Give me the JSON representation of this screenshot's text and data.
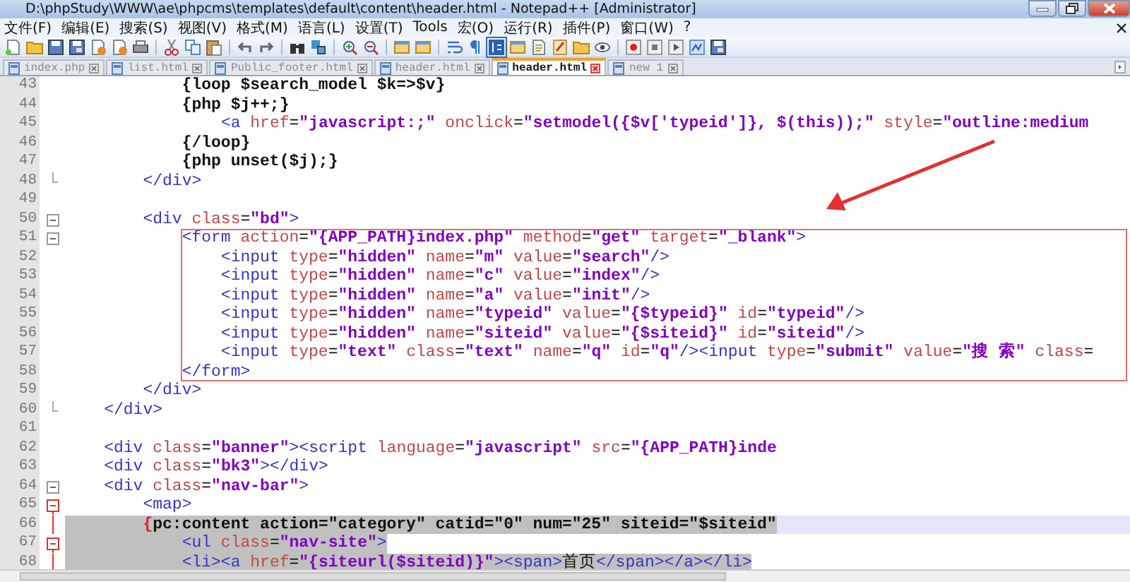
{
  "window": {
    "title": "D:\\phpStudy\\WWW\\ae\\phpcms\\templates\\default\\content\\header.html - Notepad++ [Administrator]"
  },
  "menu": [
    "文件(F)",
    "编辑(E)",
    "搜索(S)",
    "视图(V)",
    "格式(M)",
    "语言(L)",
    "设置(T)",
    "Tools",
    "宏(O)",
    "运行(R)",
    "插件(P)",
    "窗口(W)",
    "?"
  ],
  "tabs": [
    {
      "label": "index.php",
      "selected": false
    },
    {
      "label": "list.html",
      "selected": false
    },
    {
      "label": "Public_footer.html",
      "selected": false
    },
    {
      "label": "header.html",
      "selected": false
    },
    {
      "label": "header.html",
      "selected": true
    },
    {
      "label": "new 1",
      "selected": false
    }
  ],
  "editor": {
    "lines": [
      {
        "number": "43",
        "fold": false,
        "fold_end": false,
        "active": false,
        "current": false,
        "selected": false,
        "tokens": [
          {
            "kind": "tpl",
            "text": "            {loop $search_model $k=>$v}"
          }
        ]
      },
      {
        "number": "44",
        "fold": false,
        "fold_end": false,
        "active": false,
        "current": false,
        "selected": false,
        "tokens": [
          {
            "kind": "tpl",
            "text": "            {php $j++;}"
          }
        ]
      },
      {
        "number": "45",
        "fold": false,
        "fold_end": false,
        "active": false,
        "current": false,
        "selected": false,
        "tokens": [
          {
            "kind": "tag",
            "text": "                <a"
          },
          {
            "kind": "attr",
            "text": " href"
          },
          {
            "kind": "plain",
            "text": "="
          },
          {
            "kind": "value",
            "text": "\"javascript:;\""
          },
          {
            "kind": "attr",
            "text": " onclick"
          },
          {
            "kind": "plain",
            "text": "="
          },
          {
            "kind": "value",
            "text": "\"setmodel({$v['typeid']}, $(this));\""
          },
          {
            "kind": "attr",
            "text": " style"
          },
          {
            "kind": "plain",
            "text": "="
          },
          {
            "kind": "value",
            "text": "\"outline:medium"
          }
        ]
      },
      {
        "number": "46",
        "fold": false,
        "fold_end": false,
        "active": false,
        "current": false,
        "selected": false,
        "tokens": [
          {
            "kind": "tpl",
            "text": "            {/loop}"
          }
        ]
      },
      {
        "number": "47",
        "fold": false,
        "fold_end": false,
        "active": false,
        "current": false,
        "selected": false,
        "tokens": [
          {
            "kind": "tpl",
            "text": "            {php unset($j);}"
          }
        ]
      },
      {
        "number": "48",
        "fold": false,
        "fold_end": true,
        "active": false,
        "current": false,
        "selected": false,
        "tokens": [
          {
            "kind": "tag",
            "text": "        </div>"
          }
        ]
      },
      {
        "number": "49",
        "fold": false,
        "fold_end": false,
        "active": false,
        "current": false,
        "selected": false
      },
      {
        "number": "50",
        "fold": true,
        "fold_end": false,
        "active": false,
        "current": false,
        "selected": false,
        "tokens": [
          {
            "kind": "tag",
            "text": "        <div"
          },
          {
            "kind": "attr",
            "text": " class"
          },
          {
            "kind": "plain",
            "text": "="
          },
          {
            "kind": "value",
            "text": "\"bd\""
          },
          {
            "kind": "tag",
            "text": ">"
          }
        ]
      },
      {
        "number": "51",
        "fold": true,
        "fold_end": false,
        "active": false,
        "current": false,
        "selected": false,
        "tokens": [
          {
            "kind": "tag",
            "text": "            <form"
          },
          {
            "kind": "attr",
            "text": " action"
          },
          {
            "kind": "plain",
            "text": "="
          },
          {
            "kind": "value",
            "text": "\"{APP_PATH}index.php\""
          },
          {
            "kind": "attr",
            "text": " method"
          },
          {
            "kind": "plain",
            "text": "="
          },
          {
            "kind": "value",
            "text": "\"get\""
          },
          {
            "kind": "attr",
            "text": " target"
          },
          {
            "kind": "plain",
            "text": "="
          },
          {
            "kind": "value",
            "text": "\"_blank\""
          },
          {
            "kind": "tag",
            "text": ">"
          }
        ]
      },
      {
        "number": "52",
        "fold": false,
        "fold_end": false,
        "active": false,
        "current": false,
        "selected": false,
        "tokens": [
          {
            "kind": "tag",
            "text": "                <input"
          },
          {
            "kind": "attr",
            "text": " type"
          },
          {
            "kind": "plain",
            "text": "="
          },
          {
            "kind": "value",
            "text": "\"hidden\""
          },
          {
            "kind": "attr",
            "text": " name"
          },
          {
            "kind": "plain",
            "text": "="
          },
          {
            "kind": "value",
            "text": "\"m\""
          },
          {
            "kind": "attr",
            "text": " value"
          },
          {
            "kind": "plain",
            "text": "="
          },
          {
            "kind": "value",
            "text": "\"search\""
          },
          {
            "kind": "tag",
            "text": "/>"
          }
        ]
      },
      {
        "number": "53",
        "fold": false,
        "fold_end": false,
        "active": false,
        "current": false,
        "selected": false,
        "tokens": [
          {
            "kind": "tag",
            "text": "                <input"
          },
          {
            "kind": "attr",
            "text": " type"
          },
          {
            "kind": "plain",
            "text": "="
          },
          {
            "kind": "value",
            "text": "\"hidden\""
          },
          {
            "kind": "attr",
            "text": " name"
          },
          {
            "kind": "plain",
            "text": "="
          },
          {
            "kind": "value",
            "text": "\"c\""
          },
          {
            "kind": "attr",
            "text": " value"
          },
          {
            "kind": "plain",
            "text": "="
          },
          {
            "kind": "value",
            "text": "\"index\""
          },
          {
            "kind": "tag",
            "text": "/>"
          }
        ]
      },
      {
        "number": "54",
        "fold": false,
        "fold_end": false,
        "active": false,
        "current": false,
        "selected": false,
        "tokens": [
          {
            "kind": "tag",
            "text": "                <input"
          },
          {
            "kind": "attr",
            "text": " type"
          },
          {
            "kind": "plain",
            "text": "="
          },
          {
            "kind": "value",
            "text": "\"hidden\""
          },
          {
            "kind": "attr",
            "text": " name"
          },
          {
            "kind": "plain",
            "text": "="
          },
          {
            "kind": "value",
            "text": "\"a\""
          },
          {
            "kind": "attr",
            "text": " value"
          },
          {
            "kind": "plain",
            "text": "="
          },
          {
            "kind": "value",
            "text": "\"init\""
          },
          {
            "kind": "tag",
            "text": "/>"
          }
        ]
      },
      {
        "number": "55",
        "fold": false,
        "fold_end": false,
        "active": false,
        "current": false,
        "selected": false,
        "tokens": [
          {
            "kind": "tag",
            "text": "                <input"
          },
          {
            "kind": "attr",
            "text": " type"
          },
          {
            "kind": "plain",
            "text": "="
          },
          {
            "kind": "value",
            "text": "\"hidden\""
          },
          {
            "kind": "attr",
            "text": " name"
          },
          {
            "kind": "plain",
            "text": "="
          },
          {
            "kind": "value",
            "text": "\"typeid\""
          },
          {
            "kind": "attr",
            "text": " value"
          },
          {
            "kind": "plain",
            "text": "="
          },
          {
            "kind": "value",
            "text": "\"{$typeid}\""
          },
          {
            "kind": "attr",
            "text": " id"
          },
          {
            "kind": "plain",
            "text": "="
          },
          {
            "kind": "value",
            "text": "\"typeid\""
          },
          {
            "kind": "tag",
            "text": "/>"
          }
        ]
      },
      {
        "number": "56",
        "fold": false,
        "fold_end": false,
        "active": false,
        "current": false,
        "selected": false,
        "tokens": [
          {
            "kind": "tag",
            "text": "                <input"
          },
          {
            "kind": "attr",
            "text": " type"
          },
          {
            "kind": "plain",
            "text": "="
          },
          {
            "kind": "value",
            "text": "\"hidden\""
          },
          {
            "kind": "attr",
            "text": " name"
          },
          {
            "kind": "plain",
            "text": "="
          },
          {
            "kind": "value",
            "text": "\"siteid\""
          },
          {
            "kind": "attr",
            "text": " value"
          },
          {
            "kind": "plain",
            "text": "="
          },
          {
            "kind": "value",
            "text": "\"{$siteid}\""
          },
          {
            "kind": "attr",
            "text": " id"
          },
          {
            "kind": "plain",
            "text": "="
          },
          {
            "kind": "value",
            "text": "\"siteid\""
          },
          {
            "kind": "tag",
            "text": "/>"
          }
        ]
      },
      {
        "number": "57",
        "fold": false,
        "fold_end": false,
        "active": false,
        "current": false,
        "selected": false,
        "tokens": [
          {
            "kind": "tag",
            "text": "                <input"
          },
          {
            "kind": "attr",
            "text": " type"
          },
          {
            "kind": "plain",
            "text": "="
          },
          {
            "kind": "value",
            "text": "\"text\""
          },
          {
            "kind": "attr",
            "text": " class"
          },
          {
            "kind": "plain",
            "text": "="
          },
          {
            "kind": "value",
            "text": "\"text\""
          },
          {
            "kind": "attr",
            "text": " name"
          },
          {
            "kind": "plain",
            "text": "="
          },
          {
            "kind": "value",
            "text": "\"q\""
          },
          {
            "kind": "attr",
            "text": " id"
          },
          {
            "kind": "plain",
            "text": "="
          },
          {
            "kind": "value",
            "text": "\"q\""
          },
          {
            "kind": "tag",
            "text": "/><input"
          },
          {
            "kind": "attr",
            "text": " type"
          },
          {
            "kind": "plain",
            "text": "="
          },
          {
            "kind": "value",
            "text": "\"submit\""
          },
          {
            "kind": "attr",
            "text": " value"
          },
          {
            "kind": "plain",
            "text": "="
          },
          {
            "kind": "value",
            "text": "\"搜 索\""
          },
          {
            "kind": "attr",
            "text": " class"
          },
          {
            "kind": "plain",
            "text": "="
          }
        ]
      },
      {
        "number": "58",
        "fold": false,
        "fold_end": false,
        "active": false,
        "current": false,
        "selected": false,
        "tokens": [
          {
            "kind": "tag",
            "text": "            </form>"
          }
        ]
      },
      {
        "number": "59",
        "fold": false,
        "fold_end": false,
        "active": false,
        "current": false,
        "selected": false,
        "tokens": [
          {
            "kind": "tag",
            "text": "        </div>"
          }
        ]
      },
      {
        "number": "60",
        "fold": false,
        "fold_end": true,
        "active": false,
        "current": false,
        "selected": false,
        "tokens": [
          {
            "kind": "tag",
            "text": "    </div>"
          }
        ]
      },
      {
        "number": "61",
        "fold": false,
        "fold_end": false,
        "active": false,
        "current": false,
        "selected": false
      },
      {
        "number": "62",
        "fold": false,
        "fold_end": false,
        "active": false,
        "current": false,
        "selected": false,
        "tokens": [
          {
            "kind": "tag",
            "text": "    <div"
          },
          {
            "kind": "attr",
            "text": " class"
          },
          {
            "kind": "plain",
            "text": "="
          },
          {
            "kind": "value",
            "text": "\"banner\""
          },
          {
            "kind": "tag",
            "text": "><script"
          },
          {
            "kind": "attr",
            "text": " language"
          },
          {
            "kind": "plain",
            "text": "="
          },
          {
            "kind": "value",
            "text": "\"javascript\""
          },
          {
            "kind": "attr",
            "text": " src"
          },
          {
            "kind": "plain",
            "text": "="
          },
          {
            "kind": "value",
            "text": "\"{APP_PATH}inde"
          }
        ]
      },
      {
        "number": "63",
        "fold": false,
        "fold_end": false,
        "active": false,
        "current": false,
        "selected": false,
        "tokens": [
          {
            "kind": "tag",
            "text": "    <div"
          },
          {
            "kind": "attr",
            "text": " class"
          },
          {
            "kind": "plain",
            "text": "="
          },
          {
            "kind": "value",
            "text": "\"bk3\""
          },
          {
            "kind": "tag",
            "text": "></div>"
          }
        ]
      },
      {
        "number": "64",
        "fold": true,
        "fold_end": false,
        "active": false,
        "current": false,
        "selected": false,
        "tokens": [
          {
            "kind": "tag",
            "text": "    <div"
          },
          {
            "kind": "attr",
            "text": " class"
          },
          {
            "kind": "plain",
            "text": "="
          },
          {
            "kind": "value",
            "text": "\"nav-bar\""
          },
          {
            "kind": "tag",
            "text": ">"
          }
        ]
      },
      {
        "number": "65",
        "fold": true,
        "fold_end": false,
        "active": true,
        "current": false,
        "selected": false,
        "tokens": [
          {
            "kind": "tag",
            "text": "        <map>"
          }
        ]
      },
      {
        "number": "66",
        "fold": false,
        "fold_end": false,
        "active": true,
        "current": true,
        "selected": true,
        "tokens": [
          {
            "kind": "brace",
            "text": "        {"
          },
          {
            "kind": "tpl",
            "text": "pc:content action=\"category\" catid=\"0\" num=\"25\" siteid=\"$siteid\""
          }
        ]
      },
      {
        "number": "67",
        "fold": true,
        "fold_end": false,
        "active": true,
        "current": false,
        "selected": true,
        "tokens": [
          {
            "kind": "tag",
            "text": "            <ul"
          },
          {
            "kind": "attr",
            "text": " class"
          },
          {
            "kind": "plain",
            "text": "="
          },
          {
            "kind": "value",
            "text": "\"nav-site\""
          },
          {
            "kind": "tag",
            "text": ">"
          }
        ]
      },
      {
        "number": "68",
        "fold": false,
        "fold_end": false,
        "active": true,
        "current": false,
        "selected": true,
        "tokens": [
          {
            "kind": "tag",
            "text": "            <li><a"
          },
          {
            "kind": "attr",
            "text": " href"
          },
          {
            "kind": "plain",
            "text": "="
          },
          {
            "kind": "value",
            "text": "\"{siteurl($siteid)}\""
          },
          {
            "kind": "tag",
            "text": "><span>"
          },
          {
            "kind": "plain",
            "text": "首页"
          },
          {
            "kind": "tag",
            "text": "</span></a></li>"
          }
        ]
      }
    ]
  }
}
